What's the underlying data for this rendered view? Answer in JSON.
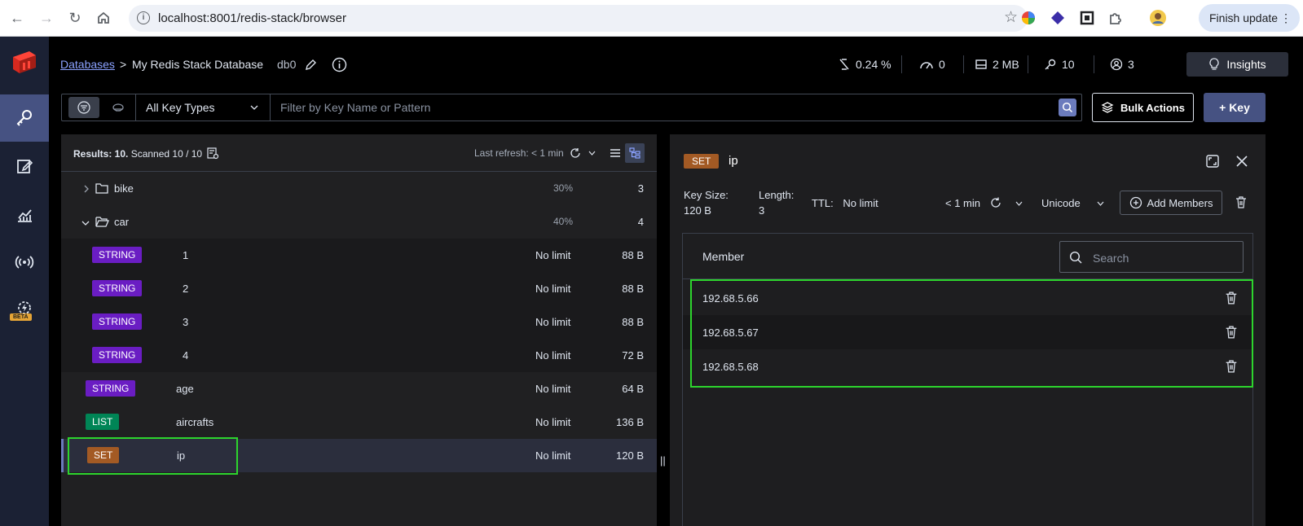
{
  "browser": {
    "url": "localhost:8001/redis-stack/browser",
    "finish_update": "Finish update"
  },
  "header": {
    "breadcrumb_root": "Databases",
    "breadcrumb_sep": ">",
    "database_name": "My Redis Stack Database",
    "db_index": "db0",
    "stats": {
      "cpu": "0.24 %",
      "ops": "0",
      "memory": "2 MB",
      "keys": "10",
      "clients": "3"
    },
    "insights_label": "Insights"
  },
  "filter": {
    "key_type": "All Key Types",
    "placeholder": "Filter by Key Name or Pattern",
    "bulk_actions": "Bulk Actions",
    "add_key": "+ Key"
  },
  "list": {
    "results_label": "Results: 10.",
    "scanned_label": "Scanned 10 / 10",
    "last_refresh": "Last refresh: < 1 min",
    "rows": [
      {
        "kind": "folder",
        "name": "bike",
        "pct": "30%",
        "size": "3",
        "expanded": false
      },
      {
        "kind": "folder",
        "name": "car",
        "pct": "40%",
        "size": "4",
        "expanded": true
      },
      {
        "kind": "key",
        "type": "STRING",
        "name": "1",
        "ttl": "No limit",
        "size": "88 B"
      },
      {
        "kind": "key",
        "type": "STRING",
        "name": "2",
        "ttl": "No limit",
        "size": "88 B"
      },
      {
        "kind": "key",
        "type": "STRING",
        "name": "3",
        "ttl": "No limit",
        "size": "88 B"
      },
      {
        "kind": "key",
        "type": "STRING",
        "name": "4",
        "ttl": "No limit",
        "size": "72 B"
      },
      {
        "kind": "key",
        "type": "STRING",
        "name": "age",
        "ttl": "No limit",
        "size": "64 B"
      },
      {
        "kind": "key",
        "type": "LIST",
        "name": "aircrafts",
        "ttl": "No limit",
        "size": "136 B"
      },
      {
        "kind": "key",
        "type": "SET",
        "name": "ip",
        "ttl": "No limit",
        "size": "120 B"
      }
    ]
  },
  "detail": {
    "type": "SET",
    "key": "ip",
    "key_size_label": "Key Size:",
    "key_size": "120 B",
    "length_label": "Length:",
    "length": "3",
    "ttl_label": "TTL:",
    "ttl": "No limit",
    "refresh": "< 1 min",
    "format": "Unicode",
    "add_members": "Add Members",
    "column": "Member",
    "search_placeholder": "Search",
    "members": [
      "192.68.5.66",
      "192.68.5.67",
      "192.68.5.68"
    ]
  },
  "colors": {
    "accent": "#465282",
    "string": "#6a1dc3",
    "list": "#008556",
    "set": "#a35a24",
    "highlight": "#2dd42d"
  }
}
